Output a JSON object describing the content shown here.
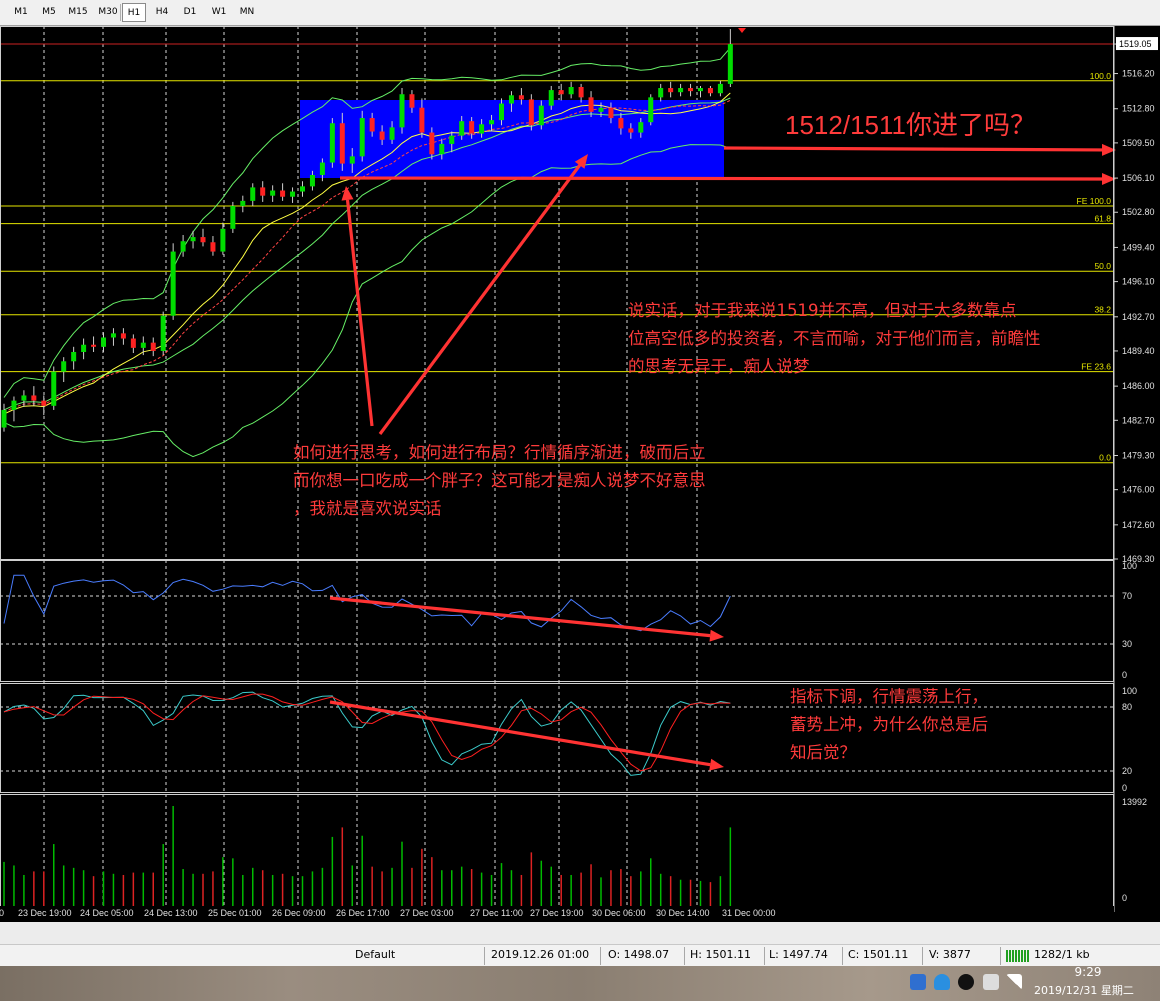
{
  "timeframes": [
    {
      "label": "M1",
      "active": false
    },
    {
      "label": "M5",
      "active": false
    },
    {
      "label": "M15",
      "active": false
    },
    {
      "label": "M30",
      "active": false
    },
    {
      "label": "H1",
      "active": true
    },
    {
      "label": "H4",
      "active": false
    },
    {
      "label": "D1",
      "active": false
    },
    {
      "label": "W1",
      "active": false
    },
    {
      "label": "MN",
      "active": false
    }
  ],
  "price_axis": {
    "ticks": [
      "1519.05",
      "1516.20",
      "1512.80",
      "1509.50",
      "1506.10",
      "1502.80",
      "1499.40",
      "1496.10",
      "1492.70",
      "1489.40",
      "1486.00",
      "1482.70",
      "1479.30",
      "1476.00",
      "1472.60",
      "1469.30"
    ],
    "current_price": "1519.05"
  },
  "fib_levels": [
    {
      "label": "100.0",
      "price": 1515.5
    },
    {
      "label": "FE 100.0",
      "price": 1503.4
    },
    {
      "label": "61.8",
      "price": 1501.7
    },
    {
      "label": "50.0",
      "price": 1497.1
    },
    {
      "label": "38.2",
      "price": 1492.9
    },
    {
      "label": "FE 23.6",
      "price": 1487.4
    },
    {
      "label": "0.0",
      "price": 1478.6
    }
  ],
  "rsi_axis": [
    "100",
    "70",
    "30",
    "0"
  ],
  "stoch_axis": [
    "100",
    "80",
    "20",
    "0"
  ],
  "volume_axis": [
    "13992",
    "0"
  ],
  "time_axis": [
    "23 Dec 19:00",
    "24 Dec 05:00",
    "24 Dec 13:00",
    "25 Dec 01:00",
    "26 Dec 09:00",
    "26 Dec 17:00",
    "27 Dec 03:00",
    "27 Dec 11:00",
    "27 Dec 19:00",
    "30 Dec 06:00",
    "30 Dec 14:00",
    "31 Dec 00:00"
  ],
  "annotations": {
    "headline": "1512/1511你进了吗？",
    "right_note": [
      "说实话，对于我来说1519并不高，但对于大多数靠点",
      "位高空低多的投资者，不言而喻，对于他们而言，前瞻性",
      "的思考无异于，痴人说梦"
    ],
    "center_note": [
      "如何进行思考，如何进行布局？行情循序渐进，破而后立",
      "而你想一口吃成一个胖子？这可能才是痴人说梦不好意思",
      "，我就是喜欢说实话"
    ],
    "indicator_note": [
      "指标下调，行情震荡上行，",
      "蓄势上冲，为什么你总是后",
      "知后觉？"
    ]
  },
  "status_bar": {
    "profile": "Default",
    "datetime": "2019.12.26 01:00",
    "open": "O: 1498.07",
    "high": "H: 1501.11",
    "low": "L: 1497.74",
    "close": "C: 1501.11",
    "volume": "V: 3877",
    "traffic": "1282/1 kb"
  },
  "clock": {
    "time": "9:29",
    "date": "2019/12/31 星期二"
  },
  "colors": {
    "bull": "#00dd00",
    "bear": "#ff2222",
    "grid": "#d8d8d8",
    "fib": "#e6e600",
    "highlight": "#0000ff",
    "arrow": "#ff3333",
    "text_red": "#ff3b3b",
    "rsi": "#4a7dff",
    "stoch_main": "#3ccccc",
    "stoch_signal": "#ff2020",
    "volume_bull": "#00bb00",
    "volume_bear": "#dd2222",
    "bollinger": "#66ee66",
    "ma_fast": "#ffff44",
    "ma_slow": "#ff4444"
  },
  "chart_data": {
    "type": "candlestick",
    "symbol_timeframe": "H1",
    "ylim": [
      1469.3,
      1520.6
    ],
    "candles": [
      [
        1482.0,
        1484.3,
        1481.6,
        1483.7
      ],
      [
        1483.7,
        1485.0,
        1482.6,
        1484.6
      ],
      [
        1484.6,
        1485.6,
        1484.0,
        1485.1
      ],
      [
        1485.1,
        1486.0,
        1484.1,
        1484.6
      ],
      [
        1484.6,
        1485.1,
        1483.2,
        1484.1
      ],
      [
        1484.1,
        1487.9,
        1483.7,
        1487.4
      ],
      [
        1487.4,
        1488.8,
        1486.4,
        1488.4
      ],
      [
        1488.4,
        1489.8,
        1487.6,
        1489.3
      ],
      [
        1489.3,
        1490.6,
        1488.6,
        1490.0
      ],
      [
        1490.0,
        1490.8,
        1489.3,
        1489.8
      ],
      [
        1489.8,
        1491.2,
        1489.3,
        1490.7
      ],
      [
        1490.7,
        1491.6,
        1489.9,
        1491.1
      ],
      [
        1491.1,
        1491.6,
        1490.0,
        1490.6
      ],
      [
        1490.6,
        1491.0,
        1489.2,
        1489.7
      ],
      [
        1489.7,
        1490.8,
        1489.0,
        1490.2
      ],
      [
        1490.2,
        1490.7,
        1488.9,
        1489.4
      ],
      [
        1489.4,
        1493.2,
        1489.0,
        1492.8
      ],
      [
        1492.8,
        1499.8,
        1492.4,
        1499.0
      ],
      [
        1499.0,
        1500.6,
        1498.5,
        1500.0
      ],
      [
        1500.0,
        1501.0,
        1499.3,
        1500.4
      ],
      [
        1500.4,
        1501.2,
        1499.5,
        1499.9
      ],
      [
        1499.9,
        1500.5,
        1498.6,
        1499.0
      ],
      [
        1499.0,
        1501.8,
        1498.7,
        1501.2
      ],
      [
        1501.2,
        1503.8,
        1500.8,
        1503.4
      ],
      [
        1503.4,
        1504.4,
        1502.8,
        1503.9
      ],
      [
        1503.9,
        1505.6,
        1503.4,
        1505.2
      ],
      [
        1505.2,
        1505.8,
        1503.8,
        1504.4
      ],
      [
        1504.4,
        1505.4,
        1503.8,
        1504.9
      ],
      [
        1504.9,
        1505.6,
        1503.9,
        1504.3
      ],
      [
        1504.3,
        1505.2,
        1503.7,
        1504.8
      ],
      [
        1504.8,
        1505.8,
        1504.3,
        1505.3
      ],
      [
        1505.3,
        1506.8,
        1504.9,
        1506.4
      ],
      [
        1506.4,
        1508.0,
        1505.8,
        1507.6
      ],
      [
        1507.6,
        1511.9,
        1507.1,
        1511.4
      ],
      [
        1511.4,
        1512.4,
        1506.8,
        1507.5
      ],
      [
        1507.5,
        1509.0,
        1506.6,
        1508.2
      ],
      [
        1508.2,
        1512.6,
        1507.7,
        1511.9
      ],
      [
        1511.9,
        1512.4,
        1510.1,
        1510.6
      ],
      [
        1510.6,
        1511.2,
        1509.3,
        1509.8
      ],
      [
        1509.8,
        1511.6,
        1509.4,
        1511.0
      ],
      [
        1511.0,
        1514.8,
        1510.4,
        1514.2
      ],
      [
        1514.2,
        1514.6,
        1512.4,
        1512.9
      ],
      [
        1512.9,
        1513.8,
        1510.0,
        1510.5
      ],
      [
        1510.5,
        1511.0,
        1507.9,
        1508.4
      ],
      [
        1508.4,
        1509.9,
        1507.9,
        1509.4
      ],
      [
        1509.4,
        1510.6,
        1508.6,
        1510.2
      ],
      [
        1510.2,
        1512.1,
        1509.8,
        1511.6
      ],
      [
        1511.6,
        1512.0,
        1509.9,
        1510.4
      ],
      [
        1510.4,
        1511.8,
        1510.0,
        1511.3
      ],
      [
        1511.3,
        1512.2,
        1510.6,
        1511.7
      ],
      [
        1511.7,
        1513.8,
        1511.2,
        1513.3
      ],
      [
        1513.3,
        1514.5,
        1512.5,
        1514.1
      ],
      [
        1514.1,
        1514.8,
        1513.2,
        1513.7
      ],
      [
        1513.7,
        1514.2,
        1510.7,
        1511.2
      ],
      [
        1511.2,
        1513.6,
        1510.8,
        1513.1
      ],
      [
        1513.1,
        1515.0,
        1512.7,
        1514.6
      ],
      [
        1514.6,
        1515.2,
        1513.6,
        1514.2
      ],
      [
        1514.2,
        1515.4,
        1513.8,
        1514.9
      ],
      [
        1514.9,
        1515.2,
        1513.4,
        1513.9
      ],
      [
        1513.9,
        1514.5,
        1512.0,
        1512.5
      ],
      [
        1512.5,
        1513.4,
        1512.0,
        1512.9
      ],
      [
        1512.9,
        1513.4,
        1511.4,
        1511.9
      ],
      [
        1511.9,
        1512.4,
        1510.3,
        1510.9
      ],
      [
        1510.9,
        1511.4,
        1509.9,
        1510.5
      ],
      [
        1510.5,
        1511.9,
        1510.0,
        1511.5
      ],
      [
        1511.5,
        1514.2,
        1511.2,
        1513.9
      ],
      [
        1513.9,
        1515.2,
        1513.5,
        1514.8
      ],
      [
        1514.8,
        1515.4,
        1513.9,
        1514.4
      ],
      [
        1514.4,
        1515.2,
        1514.0,
        1514.8
      ],
      [
        1514.8,
        1515.2,
        1514.0,
        1514.5
      ],
      [
        1514.5,
        1515.0,
        1513.9,
        1514.8
      ],
      [
        1514.8,
        1515.0,
        1514.0,
        1514.3
      ],
      [
        1514.3,
        1515.5,
        1514.0,
        1515.2
      ],
      [
        1515.2,
        1520.5,
        1514.9,
        1519.05
      ]
    ]
  }
}
